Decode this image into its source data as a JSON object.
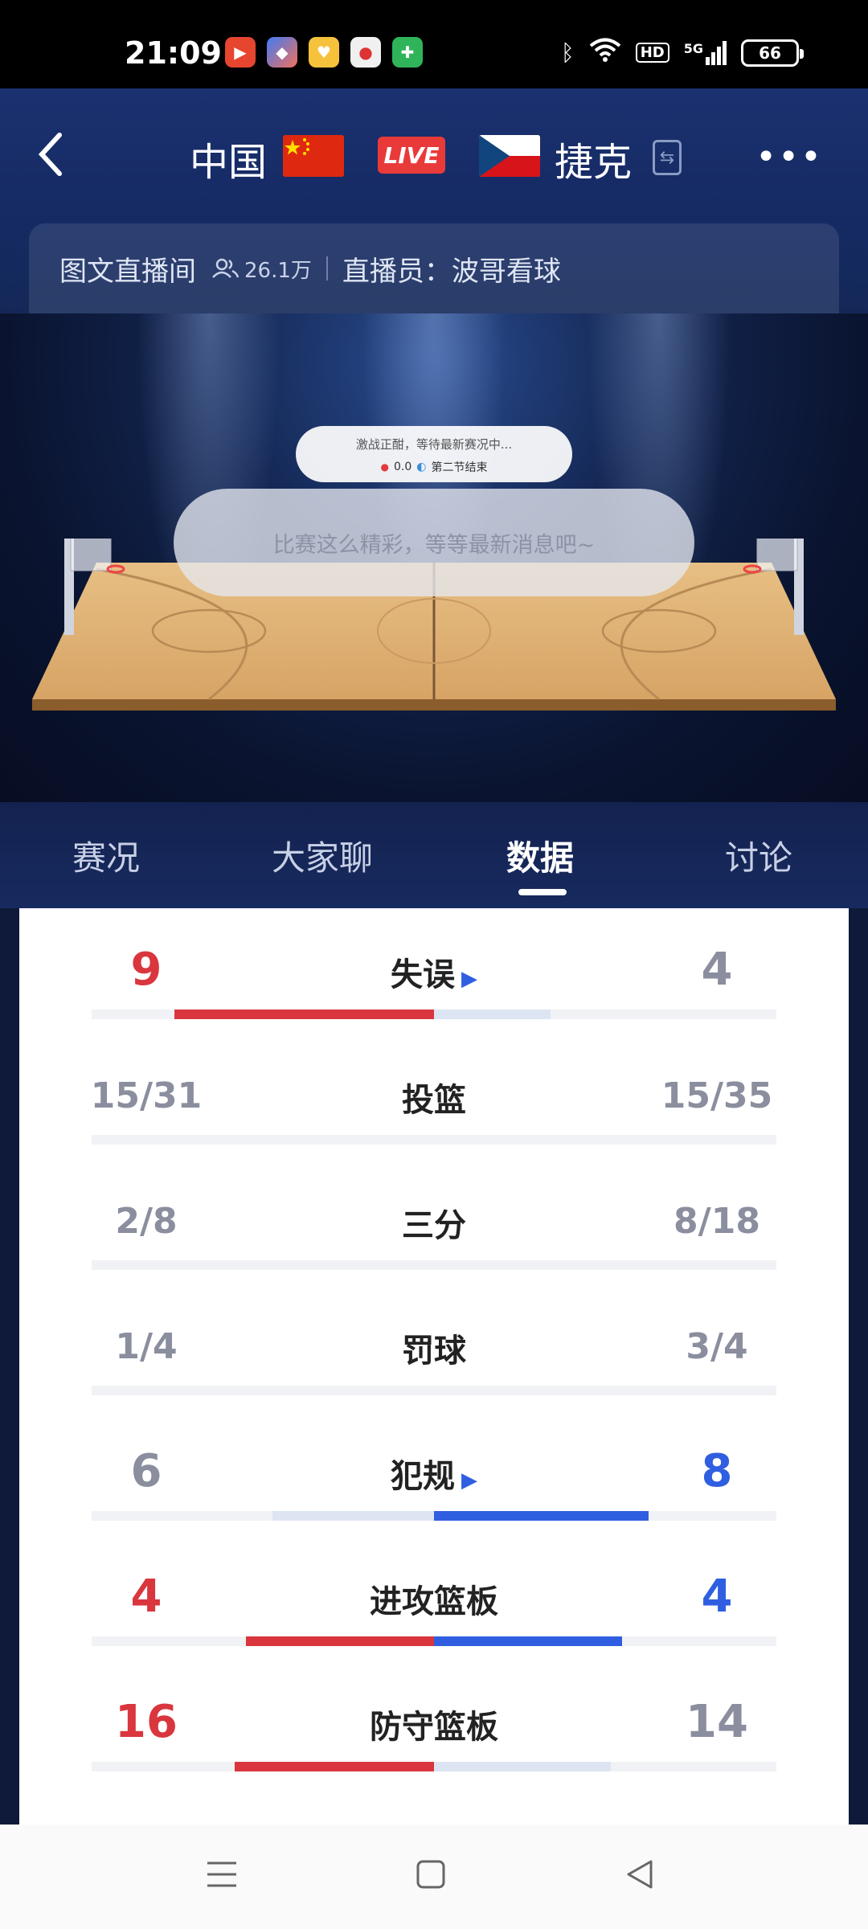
{
  "status_bar": {
    "time": "21:09",
    "network": "5G",
    "hd": "HD",
    "battery": "66",
    "icons": [
      "video-app-icon",
      "browser-app-icon",
      "heart-app-icon",
      "news-app-icon",
      "security-app-icon",
      "bluetooth-icon",
      "wifi-icon",
      "signal-icon"
    ]
  },
  "header": {
    "team_left": "中国",
    "team_right": "捷克",
    "live": "LIVE",
    "info": {
      "room": "图文直播间",
      "viewers": "26.1万",
      "host_label": "直播员：",
      "host": "波哥看球"
    }
  },
  "court": {
    "status_line1": "激战正酣，等待最新赛况中...",
    "score": "0.0",
    "period": "第二节结束",
    "wait_message": "比赛这么精彩，等等最新消息吧~"
  },
  "tabs": [
    "赛况",
    "大家聊",
    "数据",
    "讨论"
  ],
  "active_tab": "数据",
  "stats": [
    {
      "label": "失误",
      "left": "9",
      "right": "4",
      "left_ratio": 0.69,
      "right_ratio": 0.31,
      "has_arrow": true,
      "left_red": true,
      "right_blue": false
    },
    {
      "label": "投篮",
      "left": "15/31",
      "right": "15/35",
      "left_ratio": 0,
      "right_ratio": 0,
      "has_arrow": false
    },
    {
      "label": "三分",
      "left": "2/8",
      "right": "8/18",
      "left_ratio": 0,
      "right_ratio": 0,
      "has_arrow": false
    },
    {
      "label": "罚球",
      "left": "1/4",
      "right": "3/4",
      "left_ratio": 0,
      "right_ratio": 0,
      "has_arrow": false
    },
    {
      "label": "犯规",
      "left": "6",
      "right": "8",
      "left_ratio": 0.43,
      "right_ratio": 0.57,
      "has_arrow": true,
      "left_red": false,
      "right_blue": true
    },
    {
      "label": "进攻篮板",
      "left": "4",
      "right": "4",
      "left_ratio": 0.5,
      "right_ratio": 0.5,
      "has_arrow": false,
      "left_red": true,
      "right_blue": true
    },
    {
      "label": "防守篮板",
      "left": "16",
      "right": "14",
      "left_ratio": 0.53,
      "right_ratio": 0.47,
      "has_arrow": false,
      "left_red": true,
      "right_blue": false
    }
  ],
  "colors": {
    "red": "#d9363e",
    "blue": "#2f5fe0",
    "gray": "#8a8e9e",
    "track_light_blue": "#dde5f3",
    "track_light_red": "#f6dcdc"
  }
}
